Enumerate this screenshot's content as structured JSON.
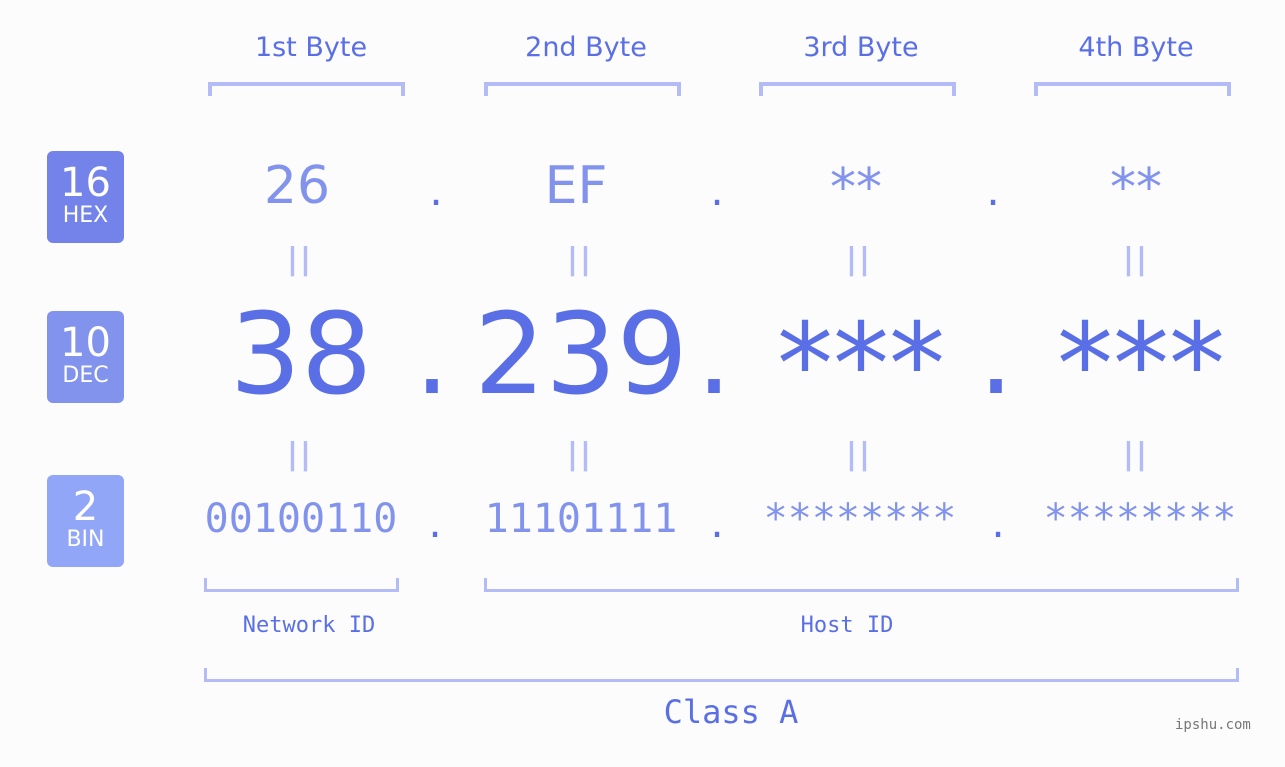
{
  "bytes": [
    {
      "header": "1st Byte",
      "hex": "26",
      "dec": "38",
      "bin": "00100110"
    },
    {
      "header": "2nd Byte",
      "hex": "EF",
      "dec": "239",
      "bin": "11101111"
    },
    {
      "header": "3rd Byte",
      "hex": "**",
      "dec": "***",
      "bin": "********"
    },
    {
      "header": "4th Byte",
      "hex": "**",
      "dec": "***",
      "bin": "********"
    }
  ],
  "bases": [
    {
      "num": "16",
      "label": "HEX",
      "color": "#7383ea"
    },
    {
      "num": "10",
      "label": "DEC",
      "color": "#8293ed"
    },
    {
      "num": "2",
      "label": "BIN",
      "color": "#91a6f6"
    }
  ],
  "separator": ".",
  "equals": "||",
  "network_label": "Network ID",
  "host_label": "Host ID",
  "class_label": "Class A",
  "watermark": "ipshu.com",
  "colors": {
    "accent": "#5a6fe6",
    "light": "#8293ed",
    "bracket": "#b3bcf7"
  }
}
